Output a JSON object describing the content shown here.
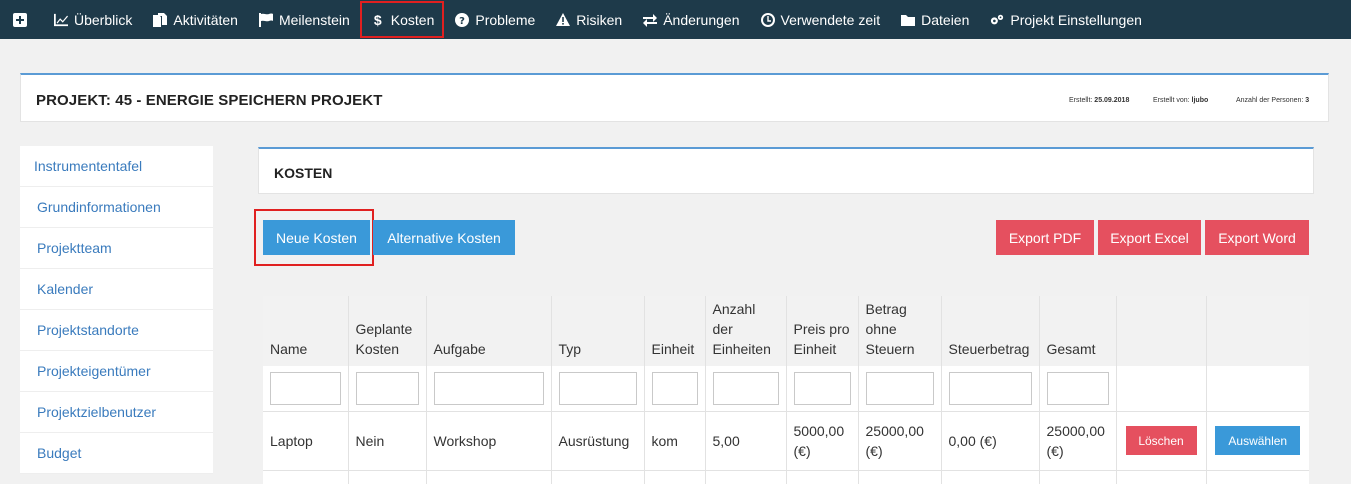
{
  "nav": {
    "items": [
      {
        "label": "",
        "icon": "plus-square-icon"
      },
      {
        "label": "Überblick",
        "icon": "line-chart-icon"
      },
      {
        "label": "Aktivitäten",
        "icon": "files-icon"
      },
      {
        "label": "Meilenstein",
        "icon": "flag-icon"
      },
      {
        "label": "Kosten",
        "icon": "dollar-icon",
        "active": true
      },
      {
        "label": "Probleme",
        "icon": "question-circle-icon"
      },
      {
        "label": "Risiken",
        "icon": "warning-icon"
      },
      {
        "label": "Änderungen",
        "icon": "exchange-icon"
      },
      {
        "label": "Verwendete zeit",
        "icon": "clock-icon"
      },
      {
        "label": "Dateien",
        "icon": "folder-icon"
      },
      {
        "label": "Projekt Einstellungen",
        "icon": "gears-icon"
      }
    ]
  },
  "project": {
    "title": "PROJEKT: 45 - ENERGIE SPEICHERN PROJEKT",
    "created_label": "Erstellt:",
    "created_value": "25.09.2018",
    "created_by_label": "Erstellt von:",
    "created_by_value": "ljubo",
    "persons_label": "Anzahl der Personen:",
    "persons_value": "3"
  },
  "sidebar": {
    "items": [
      {
        "label": "Instrumententafel"
      },
      {
        "label": "Grundinformationen"
      },
      {
        "label": "Projektteam"
      },
      {
        "label": "Kalender"
      },
      {
        "label": "Projektstandorte"
      },
      {
        "label": "Projekteigentümer"
      },
      {
        "label": "Projektzielbenutzer"
      },
      {
        "label": "Budget"
      }
    ]
  },
  "kosten": {
    "title": "KOSTEN",
    "buttons": {
      "new": "Neue Kosten",
      "alternative": "Alternative Kosten",
      "export_pdf": "Export PDF",
      "export_excel": "Export Excel",
      "export_word": "Export Word"
    },
    "table": {
      "columns": [
        "Name",
        "Geplante Kosten",
        "Aufgabe",
        "Typ",
        "Einheit",
        "Anzahl der Einheiten",
        "Preis pro Einheit",
        "Betrag ohne Steuern",
        "Steuerbetrag",
        "Gesamt",
        "",
        ""
      ],
      "rows": [
        {
          "name": "Laptop",
          "planned": "Nein",
          "task": "Workshop",
          "type": "Ausrüstung",
          "unit": "kom",
          "quantity": "5,00",
          "unit_price": "5000,00 (€)",
          "amount_net": "25000,00 (€)",
          "tax": "0,00 (€)",
          "total": "25000,00 (€)",
          "delete_label": "Löschen",
          "select_label": "Auswählen"
        }
      ]
    }
  },
  "colors": {
    "nav_bg": "#1e3a4a",
    "accent_blue": "#3a99d9",
    "danger_red": "#e5505f",
    "link_blue": "#3a7bbd",
    "panel_border_top": "#5b9bd5"
  }
}
